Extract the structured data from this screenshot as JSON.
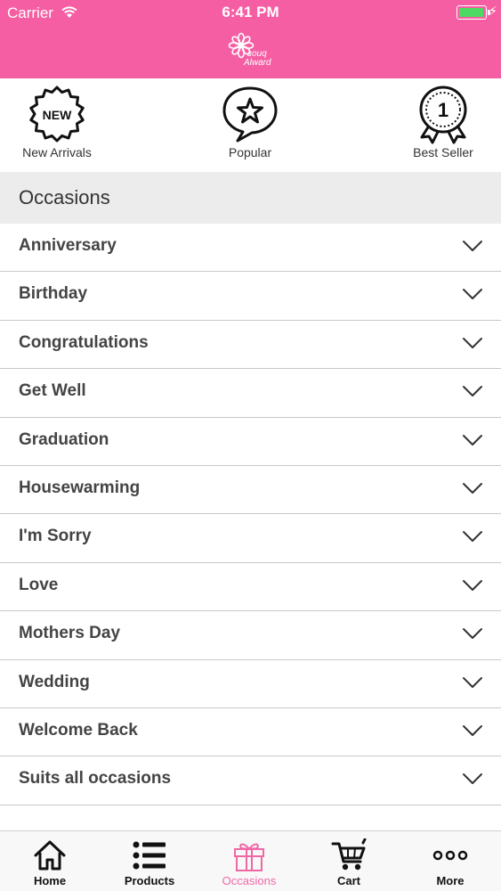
{
  "status_bar": {
    "carrier": "Carrier",
    "time": "6:41 PM"
  },
  "logo": {
    "line1": "souq",
    "line2": "Alward"
  },
  "quick_links": [
    {
      "label": "New Arrivals",
      "badge": "NEW",
      "icon": "new-badge-icon"
    },
    {
      "label": "Popular",
      "icon": "star-bubble-icon"
    },
    {
      "label": "Best Seller",
      "badge": "1",
      "icon": "award-ribbon-icon"
    }
  ],
  "section": {
    "title": "Occasions"
  },
  "occasions": [
    "Anniversary",
    "Birthday",
    "Congratulations",
    "Get Well",
    "Graduation",
    "Housewarming",
    "I'm Sorry",
    "Love",
    "Mothers Day",
    "Wedding",
    "Welcome Back",
    "Suits all occasions"
  ],
  "tab_bar": {
    "tabs": [
      {
        "label": "Home",
        "icon": "home-icon"
      },
      {
        "label": "Products",
        "icon": "list-icon"
      },
      {
        "label": "Occasions",
        "icon": "gift-icon",
        "active": true
      },
      {
        "label": "Cart",
        "icon": "cart-icon"
      },
      {
        "label": "More",
        "icon": "more-icon"
      }
    ]
  },
  "colors": {
    "brand_pink": "#f55ea3",
    "active_tab": "#f067a6",
    "battery": "#4cd964"
  }
}
